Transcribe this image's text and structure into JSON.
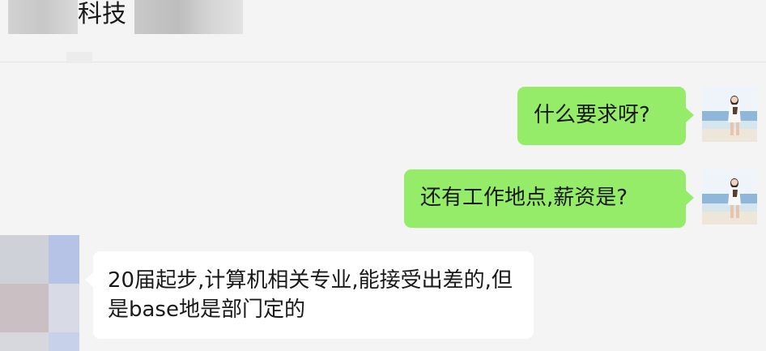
{
  "header": {
    "title_visible": "科技"
  },
  "messages": [
    {
      "sender": "me",
      "text": "什么要求呀?"
    },
    {
      "sender": "me",
      "text": "还有工作地点,薪资是?"
    },
    {
      "sender": "peer",
      "text": "20届起步,计算机相关专业,能接受出差的,但是base地是部门定的"
    }
  ],
  "colors": {
    "background": "#f4f4f4",
    "outgoing_bubble": "#95ec69",
    "incoming_bubble": "#ffffff",
    "text": "#191919"
  },
  "icons": {
    "my_avatar": "beach-photo-avatar",
    "peer_avatar": "pixelated-avatar"
  }
}
